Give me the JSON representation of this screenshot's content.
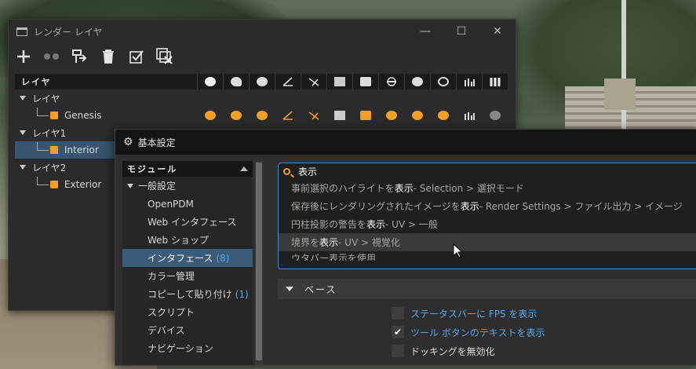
{
  "layer_window": {
    "title": "レンダー レイヤ",
    "controls": {
      "minimize": "—",
      "maximize": "☐",
      "close": "✕"
    },
    "header_label": "レイヤ",
    "rows": [
      {
        "label": "レイヤ",
        "level": 0
      },
      {
        "label": "Genesis",
        "level": 1
      },
      {
        "label": "レイヤ1",
        "level": 0
      },
      {
        "label": "Interior",
        "level": 1,
        "selected": true
      },
      {
        "label": "レイヤ2",
        "level": 0
      },
      {
        "label": "Exterior",
        "level": 1
      }
    ],
    "accent_color": "#f0a028",
    "selected_color": "#38546f"
  },
  "preferences": {
    "title": "基本設定",
    "modules_header": "モジュール",
    "modules": [
      {
        "label": "一般設定",
        "type": "group"
      },
      {
        "label": "OpenPDM",
        "type": "sub"
      },
      {
        "label": "Web インタフェース",
        "type": "sub"
      },
      {
        "label": "Web ショップ",
        "type": "sub"
      },
      {
        "label": "インタフェース",
        "count": "(8)",
        "type": "sub",
        "selected": true
      },
      {
        "label": "カラー管理",
        "type": "sub"
      },
      {
        "label": "コピーして貼り付け",
        "count": "(1)",
        "type": "sub"
      },
      {
        "label": "スクリプト",
        "type": "sub"
      },
      {
        "label": "デバイス",
        "type": "sub"
      },
      {
        "label": "ナビゲーション",
        "type": "sub"
      }
    ],
    "search": {
      "value": "表示",
      "results": [
        {
          "pre": "事前選択のハイライトを",
          "match": "表示",
          "post": " - Selection > 選択モード"
        },
        {
          "pre": "保存後にレンダリングされたイメージを",
          "match": "表示",
          "post": " - Render Settings > ファイル出力 > イメージ"
        },
        {
          "pre": "円柱投影の警告を",
          "match": "表示",
          "post": " - UV > 一般"
        },
        {
          "pre": "境界を",
          "match": "表示",
          "post": " - UV > 視覚化"
        },
        {
          "pre": "ウタバー表示を使用",
          "match": "",
          "post": "",
          "cut": true
        }
      ]
    },
    "section_title": "ベース",
    "options": [
      {
        "label": "ステータスバーに FPS を表示",
        "checked": false
      },
      {
        "label": "ツール ボタンのテキストを表示",
        "checked": true
      },
      {
        "label": "ドッキングを無効化",
        "checked": false
      }
    ],
    "link_color": "#5aa7e8",
    "selected_color": "#3a5c7a"
  }
}
